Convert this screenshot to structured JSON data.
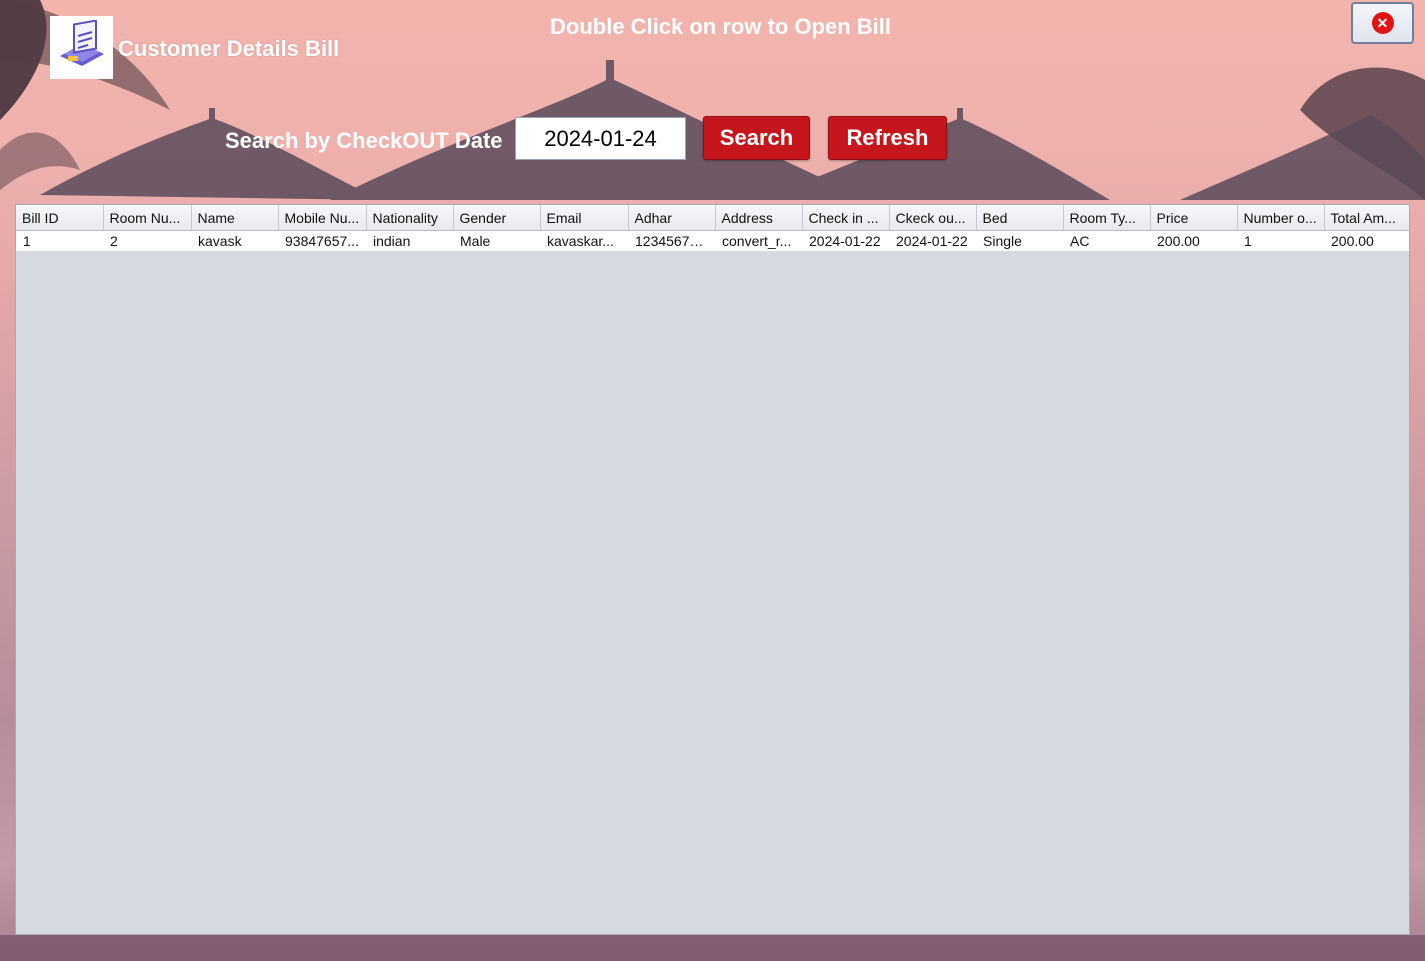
{
  "header": {
    "title": "Customer Details Bill",
    "hint": "Double Click on row to Open Bill",
    "close_icon": "close-icon",
    "close_color": "#e01414"
  },
  "search": {
    "label": "Search by CheckOUT Date",
    "date_value": "2024-01-24",
    "search_button": "Search",
    "refresh_button": "Refresh",
    "button_color": "#c4161c"
  },
  "table": {
    "columns": [
      "Bill ID",
      "Room Nu...",
      "Name",
      "Mobile Nu...",
      "Nationality",
      "Gender",
      "Email",
      "Adhar",
      "Address",
      "Check in ...",
      "Ckeck ou...",
      "Bed",
      "Room Ty...",
      "Price",
      "Number o...",
      "Total Am..."
    ],
    "rows": [
      [
        "1",
        "2",
        "kavask",
        "93847657...",
        "indian",
        "Male",
        "kavaskar...",
        "12345678...",
        "convert_r...",
        "2024-01-22",
        "2024-01-22",
        "Single",
        "AC",
        "200.00",
        "1",
        "200.00"
      ]
    ]
  }
}
